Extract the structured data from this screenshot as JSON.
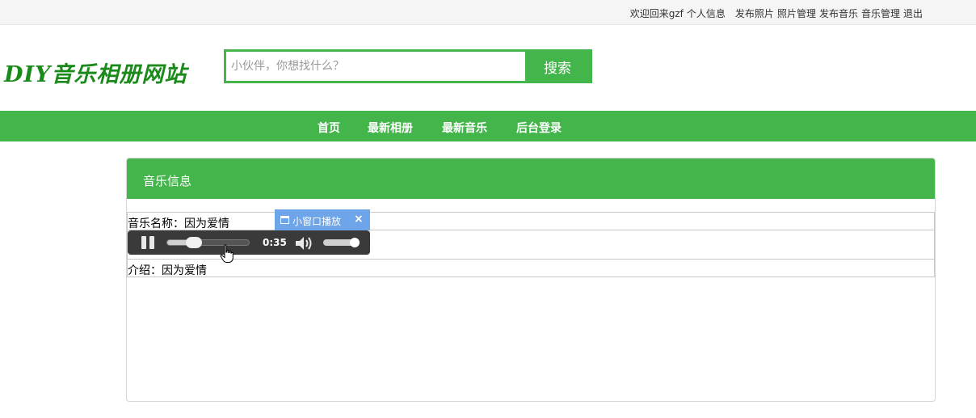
{
  "topbar": {
    "welcome": "欢迎回来gzf",
    "profile": "个人信息",
    "publish_photo": "发布照片",
    "photo_manage": "照片管理",
    "publish_music": "发布音乐",
    "music_manage": "音乐管理",
    "logout": "退出"
  },
  "logo": {
    "text": "DIY音乐相册网站"
  },
  "search": {
    "placeholder": "小伙伴，你想找什么？",
    "value": "",
    "button_label": "搜索"
  },
  "nav": {
    "items": [
      {
        "label": "首页"
      },
      {
        "label": "最新相册"
      },
      {
        "label": "最新音乐"
      },
      {
        "label": "后台登录"
      }
    ]
  },
  "panel": {
    "title": "音乐信息"
  },
  "music": {
    "name_label": "音乐名称：",
    "name": "因为爱情",
    "desc_label": "介绍：",
    "desc": "因为爱情"
  },
  "mini_window": {
    "label": "小窗口播放",
    "close": "×"
  },
  "player": {
    "state": "playing",
    "current_time": "0:35",
    "progress_fraction": 0.33,
    "volume_fraction": 0.9
  },
  "colors": {
    "brand_green": "#43b54a",
    "logo_green": "#1a8a1a",
    "mini_blue": "#6ea4e8",
    "player_dark": "#3a3a3a"
  },
  "icons": [
    "window-icon",
    "close-icon",
    "pause-icon",
    "volume-icon",
    "hand-cursor-icon"
  ]
}
